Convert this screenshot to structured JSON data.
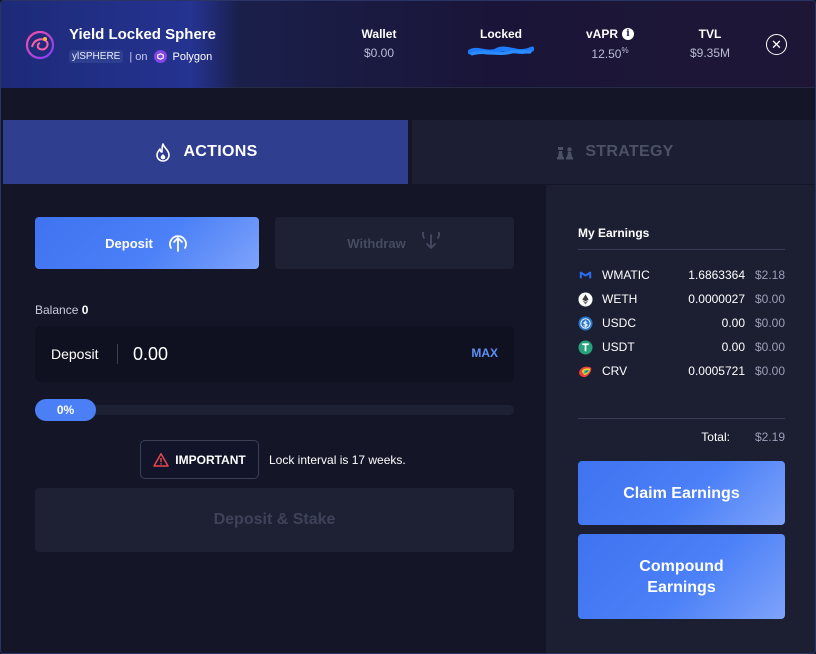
{
  "vault": {
    "name": "Yield Locked Sphere",
    "symbol": "ylSPHERE",
    "network_prefix": "| on",
    "network": "Polygon"
  },
  "stats": {
    "wallet": {
      "label": "Wallet",
      "value": "$0.00"
    },
    "locked": {
      "label": "Locked",
      "value": ""
    },
    "vapr": {
      "label": "vAPR",
      "value": "12.50",
      "suffix": "%",
      "info_icon": "i"
    },
    "tvl": {
      "label": "TVL",
      "value": "$9.35M"
    }
  },
  "close_icon": "✕",
  "tabs": [
    {
      "label": "ACTIONS",
      "icon": "flame-icon",
      "active": true
    },
    {
      "label": "STRATEGY",
      "icon": "chess-icon",
      "active": false
    }
  ],
  "actions": {
    "deposit_label": "Deposit",
    "withdraw_label": "Withdraw",
    "balance_label": "Balance",
    "balance_value": "0",
    "input_label": "Deposit",
    "input_value": "0.00",
    "max_label": "MAX",
    "slider_percent": "0%",
    "important_label": "IMPORTANT",
    "important_text": "Lock interval is 17 weeks.",
    "deposit_stake_label": "Deposit & Stake"
  },
  "earnings": {
    "title": "My Earnings",
    "items": [
      {
        "symbol": "WMATIC",
        "amount": "1.6863364",
        "usd": "$2.18",
        "icon": "wmatic-icon",
        "color": "#2f6bf0"
      },
      {
        "symbol": "WETH",
        "amount": "0.0000027",
        "usd": "$0.00",
        "icon": "eth-icon",
        "color": "#ffffff"
      },
      {
        "symbol": "USDC",
        "amount": "0.00",
        "usd": "$0.00",
        "icon": "usdc-icon",
        "color": "#2775ca"
      },
      {
        "symbol": "USDT",
        "amount": "0.00",
        "usd": "$0.00",
        "icon": "usdt-icon",
        "color": "#26a17b"
      },
      {
        "symbol": "CRV",
        "amount": "0.0005721",
        "usd": "$0.00",
        "icon": "crv-icon",
        "color": "#e84142"
      }
    ],
    "total_label": "Total:",
    "total_value": "$2.19",
    "claim_label": "Claim Earnings",
    "compound_label": "Compound Earnings"
  },
  "colors": {
    "accent": "#4a7ff5",
    "background": "#141627",
    "panel": "#1c1e31",
    "tab_active": "#2f3e8e"
  }
}
